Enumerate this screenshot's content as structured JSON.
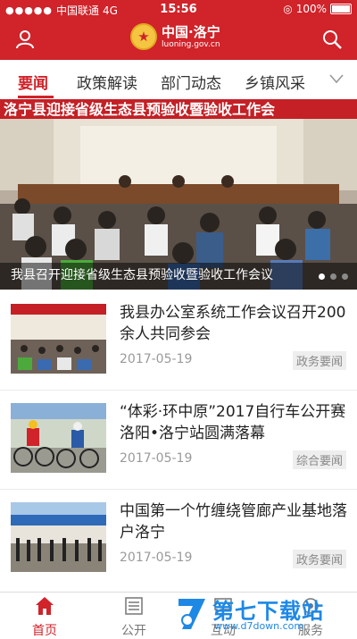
{
  "status": {
    "carrier": "中国联通",
    "network": "4G",
    "time": "15:56",
    "battery": "100%"
  },
  "header": {
    "logo_title": "中国·洛宁",
    "logo_url": "luoning.gov.cn"
  },
  "tabs": [
    {
      "label": "要闻",
      "active": true
    },
    {
      "label": "政策解读"
    },
    {
      "label": "部门动态"
    },
    {
      "label": "乡镇风采"
    }
  ],
  "banner": {
    "hall_banner_text": "洛宁县迎接省级生态县预验收暨验收工作会",
    "caption": "我县召开迎接省级生态县预验收暨验收工作会议",
    "dots": 3,
    "active_dot": 0
  },
  "news": [
    {
      "title": "我县办公室系统工作会议召开200余人共同参会",
      "date": "2017-05-19",
      "tag": "政务要闻"
    },
    {
      "title": "“体彩·环中原”2017自行车公开赛洛阳•洛宁站圆满落幕",
      "date": "2017-05-19",
      "tag": "综合要闻"
    },
    {
      "title": "中国第一个竹缠绕管廊产业基地落户洛宁",
      "date": "2017-05-19",
      "tag": "政务要闻"
    }
  ],
  "bottom_nav": [
    {
      "label": "首页",
      "icon": "home-icon",
      "active": true
    },
    {
      "label": "公开",
      "icon": "list-icon"
    },
    {
      "label": "互动",
      "icon": "chat-icon"
    },
    {
      "label": "服务",
      "icon": "service-icon"
    }
  ],
  "watermark": {
    "text": "第七下载站",
    "url": "www.d7down.com"
  },
  "colors": {
    "brand_red": "#d0232a",
    "tag_bg": "#eeeeee",
    "watermark_blue": "#1e88e5"
  }
}
